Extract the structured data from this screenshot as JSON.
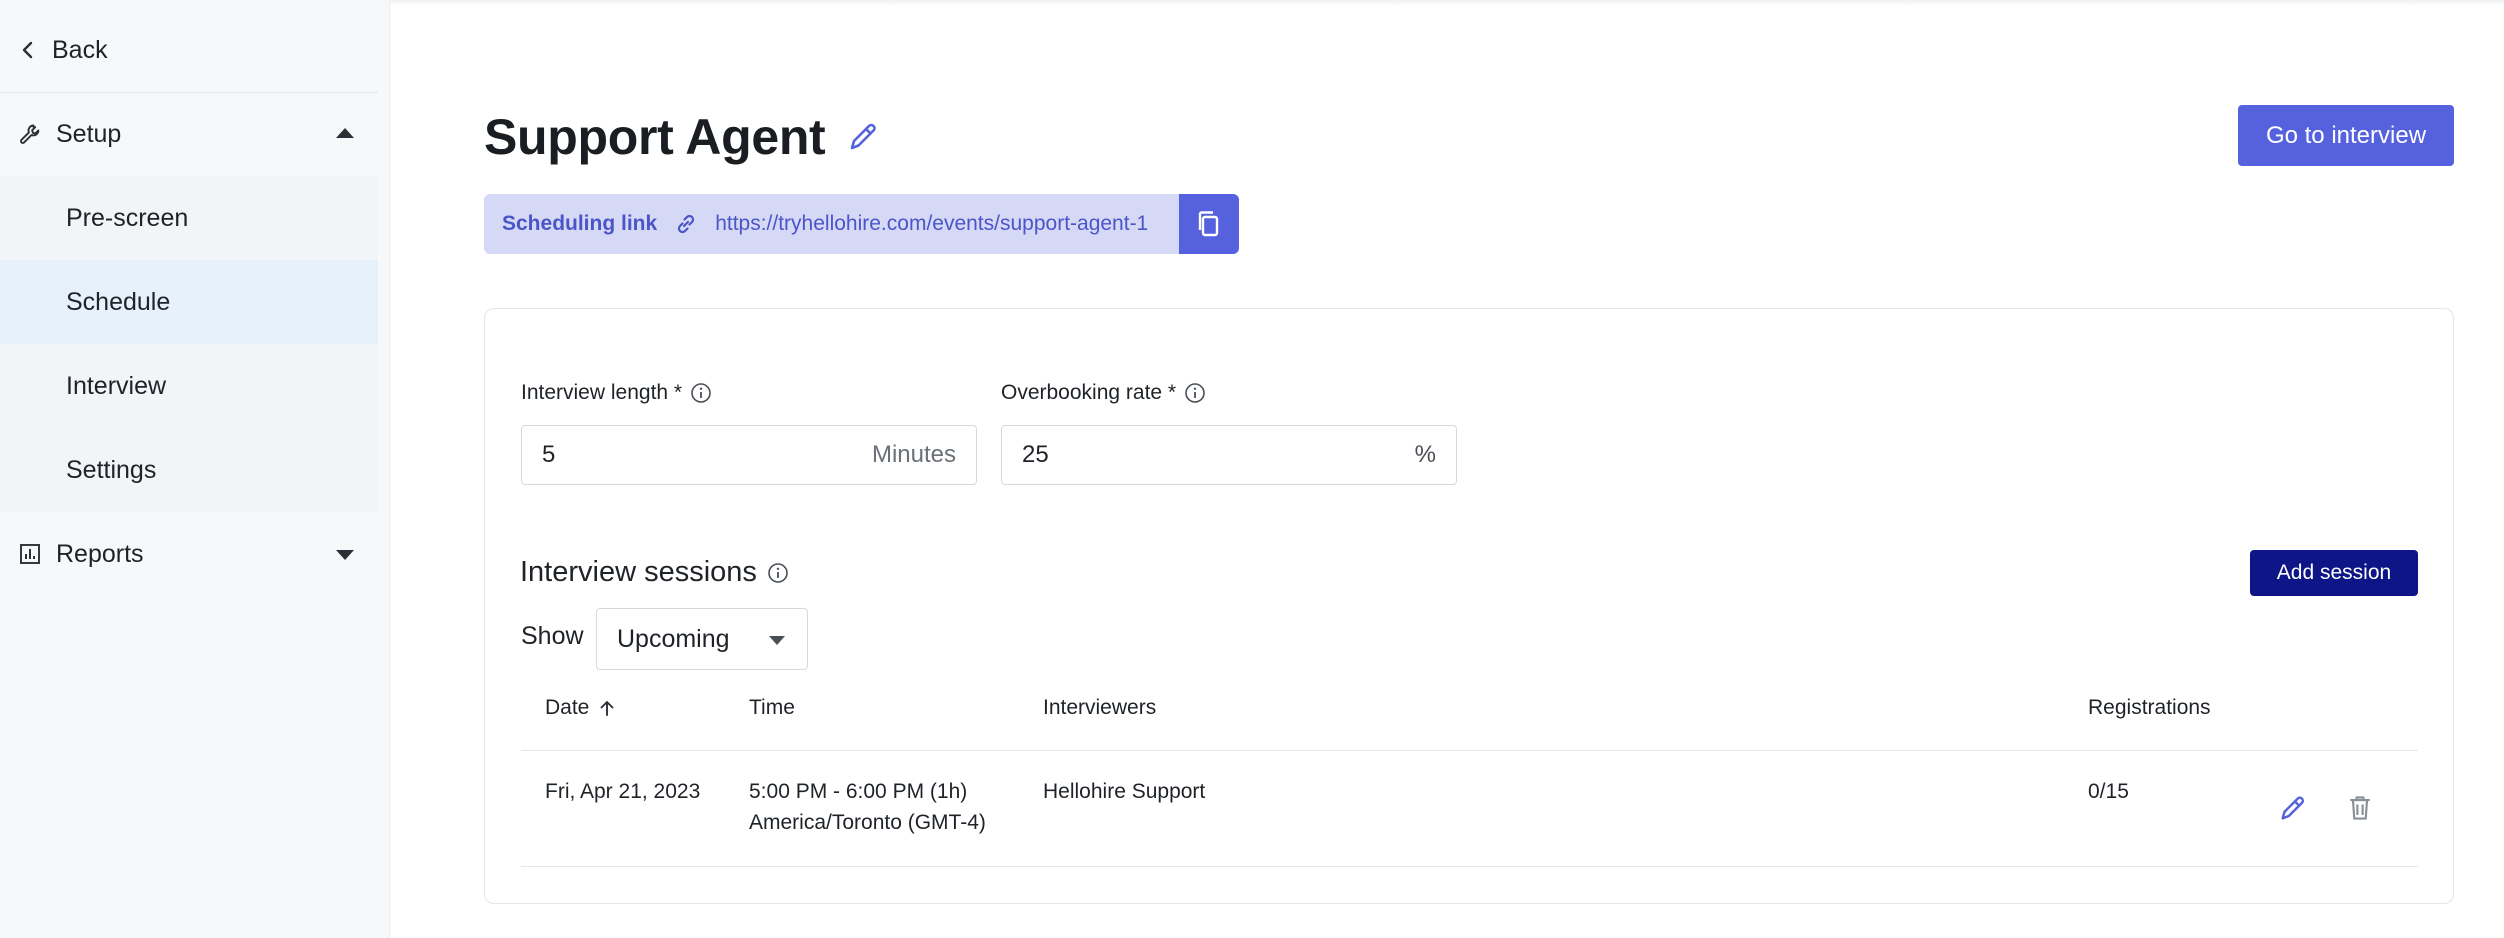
{
  "sidebar": {
    "back_label": "Back",
    "setup_label": "Setup",
    "setup_items": [
      {
        "label": "Pre-screen",
        "active": false
      },
      {
        "label": "Schedule",
        "active": true
      },
      {
        "label": "Interview",
        "active": false
      },
      {
        "label": "Settings",
        "active": false
      }
    ],
    "reports_label": "Reports"
  },
  "header": {
    "title": "Support Agent",
    "go_to_interview_label": "Go to interview",
    "scheduling_link_label": "Scheduling link",
    "scheduling_link_url": "https://tryhellohire.com/events/support-agent-1"
  },
  "settings": {
    "interview_length_label": "Interview length *",
    "interview_length_value": "5",
    "interview_length_unit": "Minutes",
    "overbooking_label": "Overbooking rate *",
    "overbooking_value": "25",
    "overbooking_unit": "%"
  },
  "sessions": {
    "title": "Interview sessions",
    "add_label": "Add session",
    "show_label": "Show",
    "filter_value": "Upcoming",
    "columns": {
      "date": "Date",
      "time": "Time",
      "interviewers": "Interviewers",
      "registrations": "Registrations"
    },
    "rows": [
      {
        "date": "Fri, Apr 21, 2023",
        "time_line1": "5:00 PM - 6:00 PM (1h)",
        "time_line2": "America/Toronto (GMT-4)",
        "interviewers": "Hellohire Support",
        "registrations": "0/15"
      }
    ]
  },
  "colors": {
    "accent": "#5661dd",
    "accent_dark": "#0d1587",
    "link_bg": "#d6d9f6",
    "active_nav_bg": "#e6f1fc"
  }
}
